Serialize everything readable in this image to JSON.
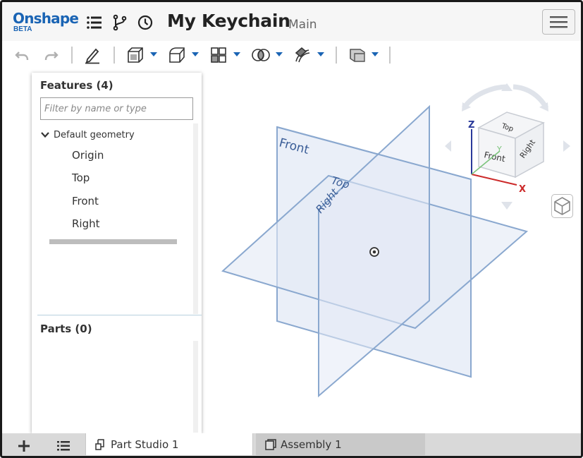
{
  "app": {
    "brand": "Onshape",
    "brand_badge": "BETA",
    "document_title": "My Keychain",
    "branch": "Main"
  },
  "topbar_icons": [
    "menu-lines-icon",
    "branch-icon",
    "history-clock-icon",
    "hamburger-menu-icon"
  ],
  "toolbar_icons": [
    "undo-icon",
    "redo-icon",
    "sketch-pencil-icon",
    "extrude-icon",
    "fillet-icon",
    "pattern-icon",
    "boolean-icon",
    "sweep-icon",
    "plane-icon"
  ],
  "features_panel": {
    "title": "Features (4)",
    "filter_placeholder": "Filter by name or type",
    "group_label": "Default geometry",
    "items": [
      {
        "label": "Origin"
      },
      {
        "label": "Top"
      },
      {
        "label": "Front"
      },
      {
        "label": "Right"
      }
    ],
    "parts_title": "Parts (0)"
  },
  "viewport": {
    "plane_labels": {
      "front": "Front",
      "top": "Top",
      "right": "Right"
    },
    "view_cube": {
      "faces": {
        "front": "Front",
        "top": "Top",
        "right": "Right"
      },
      "axes": {
        "x": "X",
        "y": "Y",
        "z": "Z"
      }
    }
  },
  "tabs": [
    {
      "label": "Part Studio 1",
      "icon": "part-studio-icon",
      "active": true
    },
    {
      "label": "Assembly 1",
      "icon": "assembly-icon",
      "active": false
    }
  ],
  "bottom_icons": [
    "add-tab-icon",
    "tab-list-icon"
  ],
  "colors": {
    "brand": "#1a64b4",
    "plane_fill": "#e3eaf5",
    "plane_stroke": "#8aa8cf",
    "plane_label": "#3a5d97",
    "axis_x": "#cc2a2a",
    "axis_y": "#7cc47c",
    "axis_z": "#2a3a9a"
  }
}
